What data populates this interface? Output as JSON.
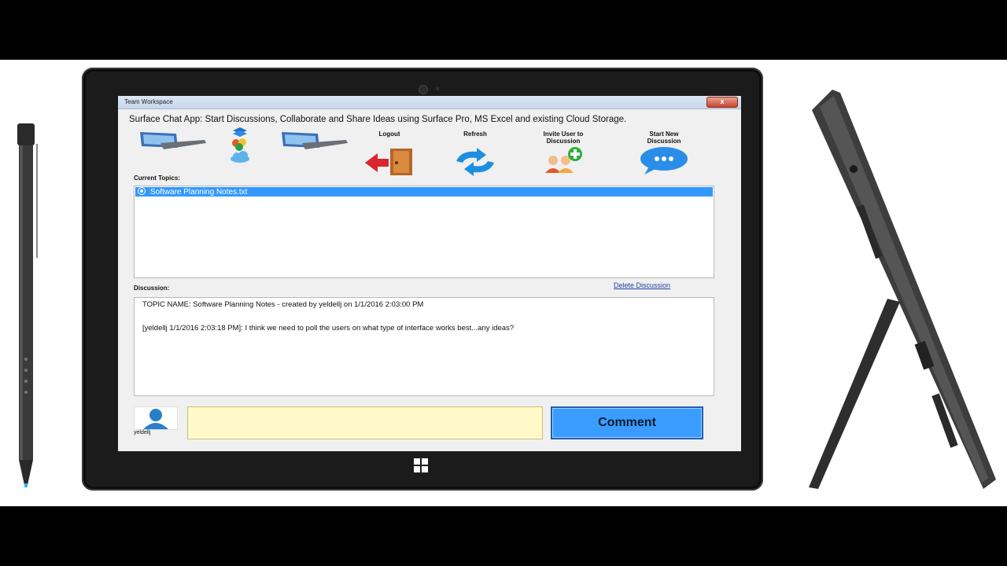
{
  "window": {
    "title": "Team Workspace",
    "close_glyph": "x"
  },
  "app": {
    "header": "Surface Chat App: Start Discussions, Collaborate and Share Ideas using Surface Pro, MS Excel and existing Cloud Storage."
  },
  "toolbar": {
    "logout": "Logout",
    "refresh": "Refresh",
    "invite_line1": "Invite User to",
    "invite_line2": "Discussion",
    "start_line1": "Start New",
    "start_line2": "Discussion"
  },
  "topics": {
    "label": "Current Topics:",
    "items": [
      "Software Planning Notes.txt"
    ]
  },
  "discussion": {
    "label": "Discussion:",
    "delete_link": "Delete Discussion",
    "lines": [
      "TOPIC NAME: Software Planning Notes - created by yeldellj on 1/1/2016 2:03:00 PM",
      "[yeldellj 1/1/2016 2:03:18 PM]: I think we need to poll the users on what type of interface works best...any ideas?"
    ]
  },
  "user": {
    "name": "yeldellj"
  },
  "comment": {
    "value": "",
    "button": "Comment"
  },
  "colors": {
    "selection": "#3399ff",
    "comment_button": "#3b9cff",
    "comment_field": "#fff9c9",
    "link": "#1a3fa8"
  }
}
